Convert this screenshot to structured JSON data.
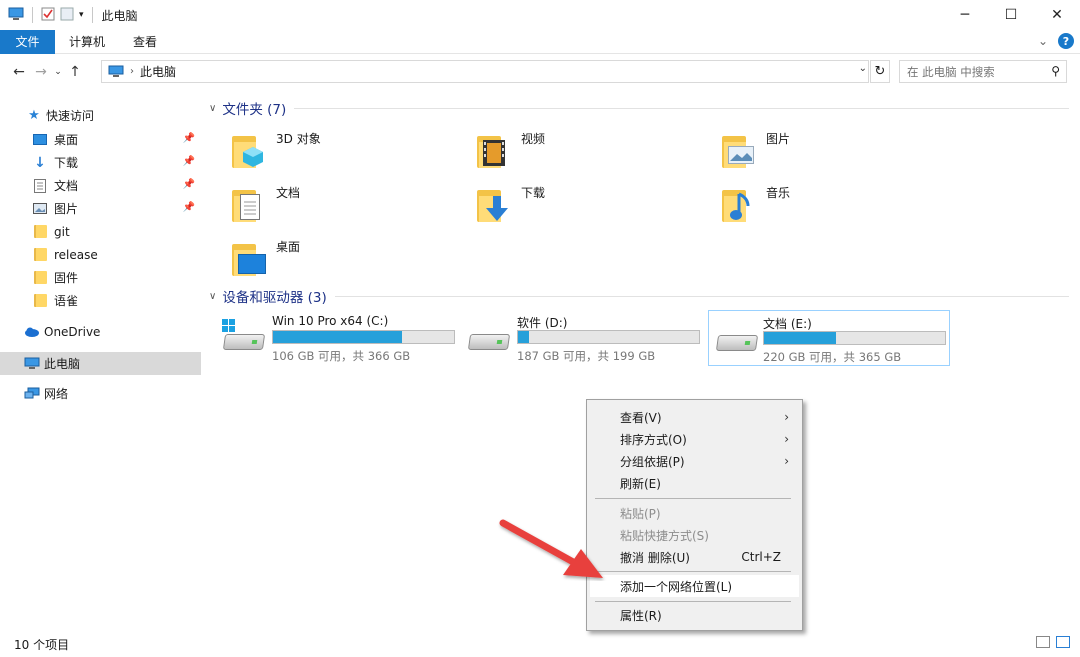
{
  "window": {
    "title": "此电脑",
    "minimize": "─",
    "maximize": "☐",
    "close": "✕"
  },
  "ribbon": {
    "tabs": [
      "文件",
      "计算机",
      "查看"
    ],
    "expand": "⌄",
    "help": "?"
  },
  "address": {
    "breadcrumb": "此电脑",
    "search_placeholder": "在 此电脑 中搜索"
  },
  "sidebar": {
    "quick_access": "快速访问",
    "pinned": [
      "桌面",
      "下载",
      "文档",
      "图片"
    ],
    "folders": [
      "git",
      "release",
      "固件",
      "语雀"
    ],
    "onedrive": "OneDrive",
    "this_pc": "此电脑",
    "network": "网络"
  },
  "groups": {
    "folders_header": "文件夹 (7)",
    "devices_header": "设备和驱动器 (3)"
  },
  "folders": [
    "3D 对象",
    "视频",
    "图片",
    "文档",
    "下载",
    "音乐",
    "桌面"
  ],
  "drives": [
    {
      "name": "Win 10 Pro x64 (C:)",
      "info": "106 GB 可用，共 366 GB",
      "used_fraction": 0.71
    },
    {
      "name": "软件 (D:)",
      "info": "187 GB 可用，共 199 GB",
      "used_fraction": 0.06
    },
    {
      "name": "文档 (E:)",
      "info": "220 GB 可用，共 365 GB",
      "used_fraction": 0.4
    }
  ],
  "context_menu": {
    "items": [
      {
        "label": "查看(V)",
        "submenu": true
      },
      {
        "label": "排序方式(O)",
        "submenu": true
      },
      {
        "label": "分组依据(P)",
        "submenu": true
      },
      {
        "label": "刷新(E)"
      },
      {
        "label": "粘贴(P)",
        "disabled": true
      },
      {
        "label": "粘贴快捷方式(S)",
        "disabled": true
      },
      {
        "label": "撤消 删除(U)",
        "shortcut": "Ctrl+Z"
      },
      {
        "label": "添加一个网络位置(L)",
        "highlighted": true
      },
      {
        "label": "属性(R)"
      }
    ]
  },
  "status": {
    "item_count": "10 个项目"
  },
  "colors": {
    "accent": "#1979ca",
    "drive_fill": "#26a0da",
    "group_header": "#1e3287",
    "annotation_arrow": "#e8413d"
  }
}
